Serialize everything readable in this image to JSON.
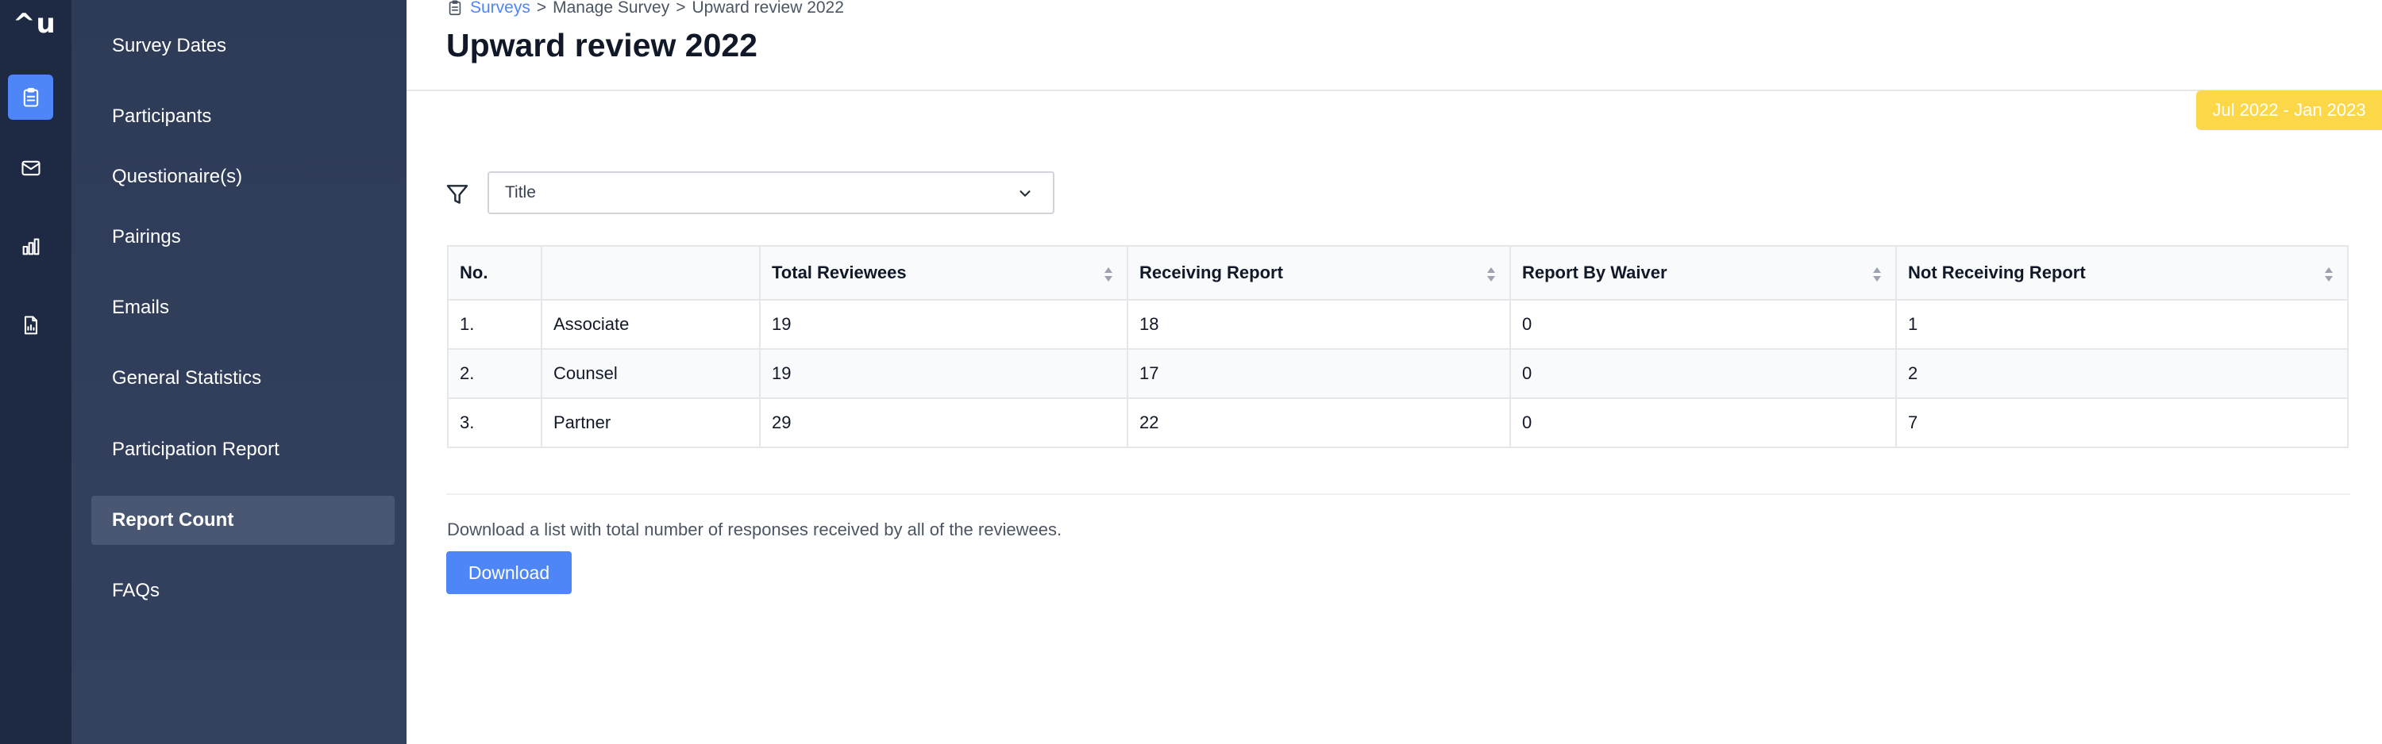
{
  "app": {
    "logo": "^u"
  },
  "rail": [
    {
      "icon": "clipboard-icon",
      "active": true
    },
    {
      "icon": "mail-icon",
      "active": false
    },
    {
      "icon": "bar-chart-icon",
      "active": false
    },
    {
      "icon": "report-file-icon",
      "active": false
    }
  ],
  "nav": {
    "items": [
      {
        "label": "Survey Dates"
      },
      {
        "label": "Participants"
      },
      {
        "label": "Questionaire(s)"
      },
      {
        "label": "Pairings"
      },
      {
        "label": "Emails"
      },
      {
        "label": "General Statistics"
      },
      {
        "label": "Participation Report"
      },
      {
        "label": "Report Count",
        "active": true
      },
      {
        "label": "FAQs"
      }
    ]
  },
  "breadcrumb": {
    "icon": "clipboard-icon",
    "root": "Surveys",
    "sep1": ">",
    "middle": "Manage Survey",
    "sep2": ">",
    "current": "Upward review 2022"
  },
  "page": {
    "title": "Upward review 2022",
    "date_range": "Jul 2022 - Jan 2023"
  },
  "filter": {
    "icon": "filter-icon",
    "selected": "Title",
    "chevron_icon": "chevron-down-icon"
  },
  "table": {
    "headers": [
      "No.",
      "",
      "Total Reviewees",
      "Receiving Report",
      "Report By Waiver",
      "Not Receiving Report"
    ],
    "sortable": [
      false,
      false,
      true,
      true,
      true,
      true
    ],
    "rows": [
      [
        "1.",
        "Associate",
        "19",
        "18",
        "0",
        "1"
      ],
      [
        "2.",
        "Counsel",
        "19",
        "17",
        "0",
        "2"
      ],
      [
        "3.",
        "Partner",
        "29",
        "22",
        "0",
        "7"
      ]
    ]
  },
  "download": {
    "help_text": "Download a list with total number of responses received by all of the reviewees.",
    "button_label": "Download"
  },
  "colors": {
    "accent": "#4f86f7",
    "rail_bg": "#1e2a44",
    "subnav_bg": "#2e3b57",
    "badge": "#fcd849"
  }
}
